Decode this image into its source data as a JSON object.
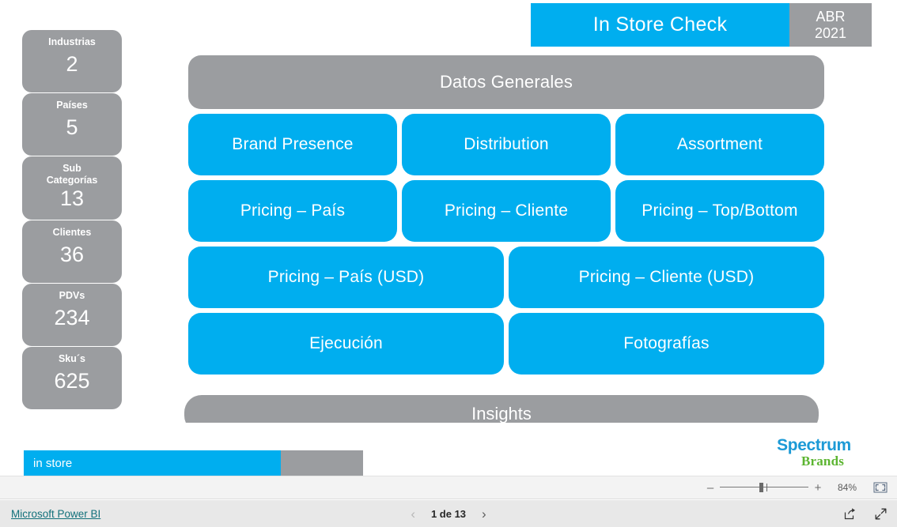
{
  "header": {
    "title": "In Store Check",
    "period_month": "ABR",
    "period_year": "2021"
  },
  "kpis": [
    {
      "label": "Industrias",
      "value": "2",
      "lines": 1
    },
    {
      "label": "Países",
      "value": "5",
      "lines": 1
    },
    {
      "label": "Sub Categorías",
      "value": "13",
      "lines": 2
    },
    {
      "label": "Clientes",
      "value": "36",
      "lines": 1
    },
    {
      "label": "PDVs",
      "value": "234",
      "lines": 1
    },
    {
      "label": "Sku´s",
      "value": "625",
      "lines": 1
    }
  ],
  "kpi_labels": {
    "industrias": "Industrias",
    "paises": "Países",
    "sub_categorias_line1": "Sub",
    "sub_categorias_line2": "Categorías",
    "clientes": "Clientes",
    "pdvs": "PDVs",
    "skus": "Sku´s"
  },
  "kpi_values": {
    "industrias": "2",
    "paises": "5",
    "sub_categorias": "13",
    "clientes": "36",
    "pdvs": "234",
    "skus": "625"
  },
  "tiles": {
    "banner": "Datos Generales",
    "row1": [
      "Brand Presence",
      "Distribution",
      "Assortment"
    ],
    "row2": [
      "Pricing – País",
      "Pricing – Cliente",
      "Pricing – Top/Bottom"
    ],
    "row3": [
      "Pricing – País (USD)",
      "Pricing – Cliente (USD)"
    ],
    "row4": [
      "Ejecución",
      "Fotografías"
    ],
    "footer": "Insights"
  },
  "tile_labels": {
    "datos_generales": "Datos Generales",
    "brand_presence": "Brand Presence",
    "distribution": "Distribution",
    "assortment": "Assortment",
    "pricing_pais": "Pricing – País",
    "pricing_cliente": "Pricing – Cliente",
    "pricing_top_bottom": "Pricing – Top/Bottom",
    "pricing_pais_usd": "Pricing – País (USD)",
    "pricing_cliente_usd": "Pricing – Cliente (USD)",
    "ejecucion": "Ejecución",
    "fotografias": "Fotografías",
    "insights": "Insights"
  },
  "in_store_bar": {
    "label": "in store"
  },
  "brand": {
    "name_top": "Spectrum",
    "name_bottom": "Brands"
  },
  "zoom_toolbar": {
    "minus": "–",
    "plus": "+",
    "percent": "84%",
    "fit_icon": "fit-to-page-icon"
  },
  "status_bar": {
    "powerbi_link": "Microsoft Power BI",
    "prev_icon": "chevron-left-icon",
    "next_icon": "chevron-right-icon",
    "page_indicator": "1 de 13",
    "share_icon": "share-icon",
    "fullscreen_icon": "fullscreen-icon"
  },
  "colors": {
    "accent_blue": "#00AEEF",
    "neutral_gray": "#9B9DA0",
    "link_teal": "#11707A",
    "brand_blue": "#1C9AD6",
    "brand_green": "#5CB531"
  }
}
